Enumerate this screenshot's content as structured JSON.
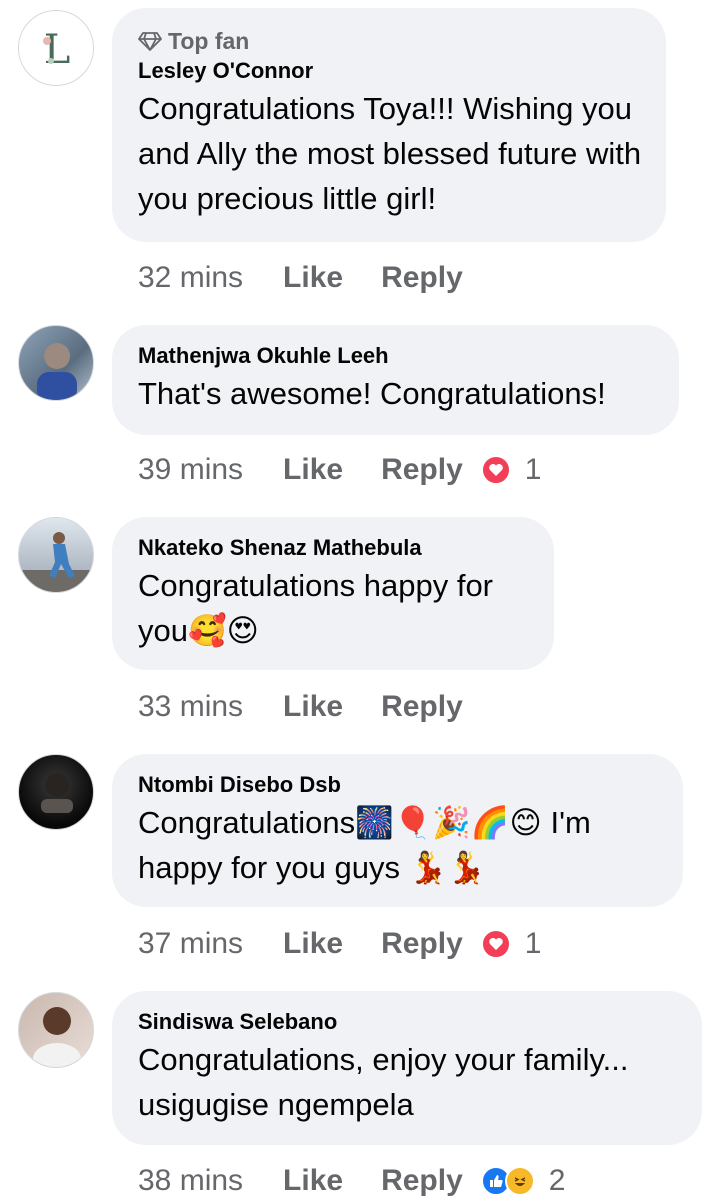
{
  "comments": [
    {
      "badge": "Top fan",
      "author": "Lesley O'Connor",
      "text": "Congratulations Toya!!! Wishing you and Ally the most blessed future with you precious little girl!",
      "time": "32 mins",
      "like": "Like",
      "reply": "Reply"
    },
    {
      "author": "Mathenjwa Okuhle Leeh",
      "text": "That's awesome! Congratulations!",
      "time": "39 mins",
      "like": "Like",
      "reply": "Reply",
      "reaction_count": "1"
    },
    {
      "author": "Nkateko Shenaz Mathebula",
      "text": "Congratulations happy for you🥰😍",
      "time": "33 mins",
      "like": "Like",
      "reply": "Reply"
    },
    {
      "author": "Ntombi Disebo Dsb",
      "text": "Congratulations🎆🎈🎉🌈😊 I'm happy for you guys 💃💃",
      "time": "37 mins",
      "like": "Like",
      "reply": "Reply",
      "reaction_count": "1"
    },
    {
      "author": "Sindiswa Selebano",
      "text": "Congratulations, enjoy your family... usigugise ngempela",
      "time": "38 mins",
      "like": "Like",
      "reply": "Reply",
      "reaction_count": "2"
    }
  ],
  "colors": {
    "bubble": "#f0f2f5",
    "meta_text": "#65676b",
    "love": "#f33e58",
    "like_blue": "#1877f2",
    "haha_yellow": "#f7b928"
  }
}
